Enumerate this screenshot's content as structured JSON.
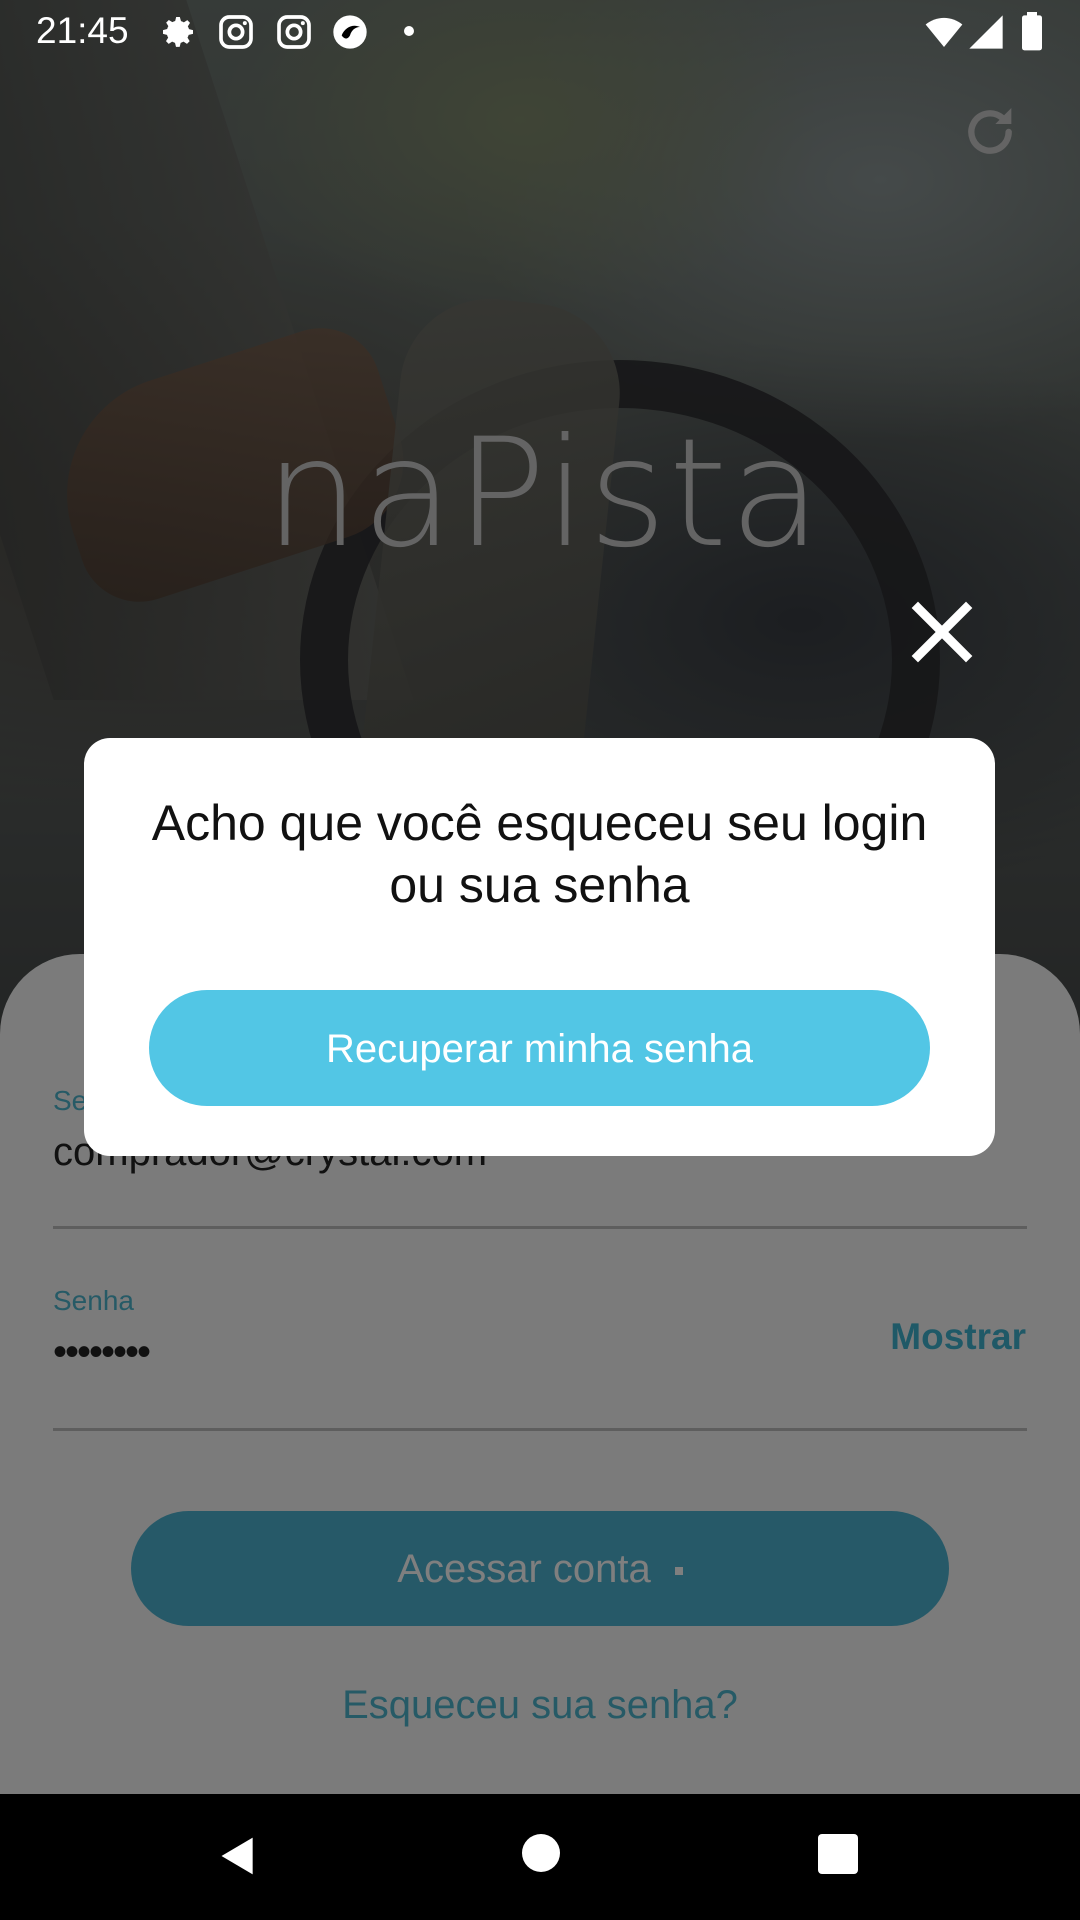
{
  "status_bar": {
    "time": "21:45",
    "icons": [
      "settings-icon",
      "instagram-icon",
      "instagram-icon",
      "app-icon",
      "notification-dot",
      "wifi-icon",
      "signal-icon",
      "battery-icon"
    ]
  },
  "brand": {
    "logo_text": "naPista"
  },
  "login_form": {
    "email_label": "Se",
    "email_value": "comprador@crystal.com",
    "password_label": "Senha",
    "password_value": "••••••••",
    "show_password_label": "Mostrar",
    "submit_label": "Acessar conta",
    "forgot_link": "Esqueceu sua senha?"
  },
  "modal": {
    "title": "Acho que você esqueceu seu login ou sua senha",
    "recover_button": "Recuperar minha senha"
  },
  "colors": {
    "accent": "#52C6E5",
    "accent_dark": "#4DB4CC",
    "overlay": "rgba(0,0,0,0.5)"
  }
}
